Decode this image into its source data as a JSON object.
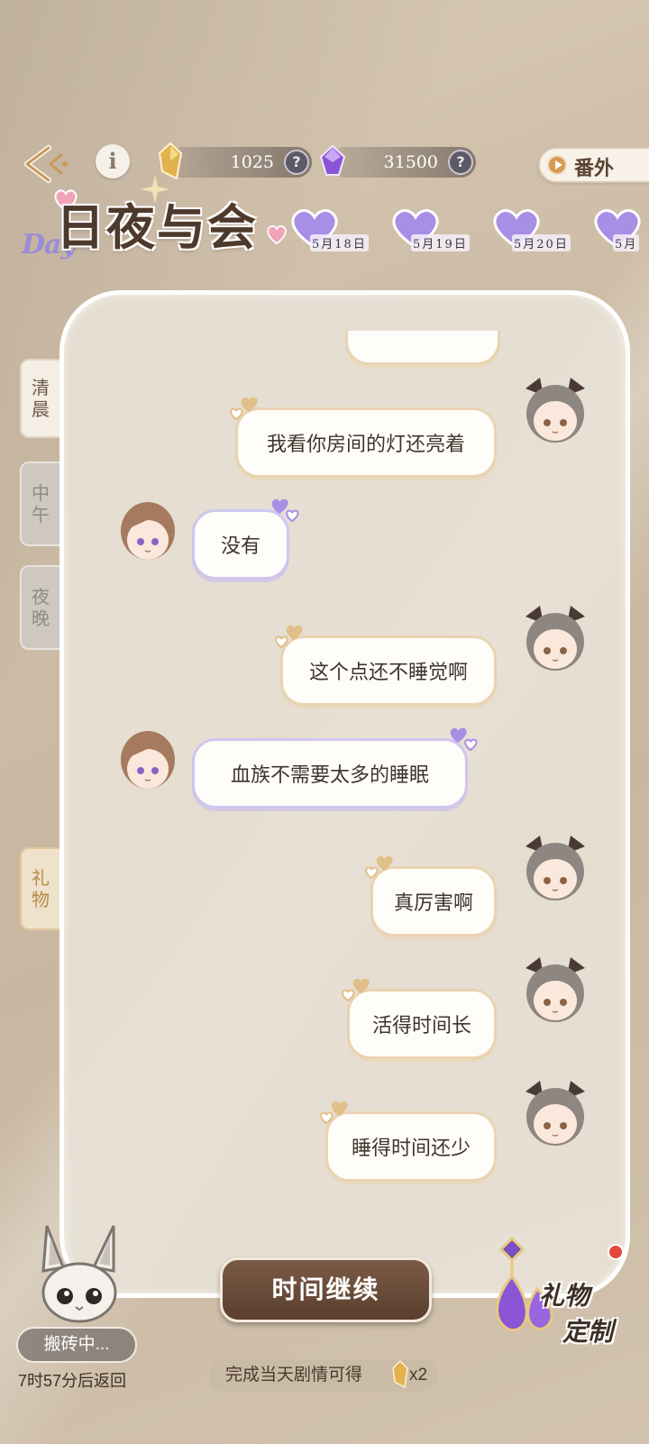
{
  "header": {
    "back_icon": "back-arrow-icon",
    "info_icon": "info-icon",
    "currencies": [
      {
        "icon": "gold-crystal-icon",
        "value": "1025",
        "help": "?"
      },
      {
        "icon": "purple-gem-icon",
        "value": "31500",
        "help": "?"
      }
    ],
    "extra_label": "番外"
  },
  "logo": {
    "day_text": "Day",
    "title": "日夜与会"
  },
  "dates": [
    "5月18日",
    "5月19日",
    "5月20日",
    "5月"
  ],
  "side_tabs": {
    "morning": [
      "清",
      "晨"
    ],
    "noon": [
      "中",
      "午"
    ],
    "night": [
      "夜",
      "晚"
    ],
    "gift": [
      "礼",
      "物"
    ]
  },
  "chat": {
    "messages": [
      {
        "from": "me",
        "text": ""
      },
      {
        "from": "me",
        "text": "我看你房间的灯还亮着"
      },
      {
        "from": "him",
        "text": "没有"
      },
      {
        "from": "me",
        "text": "这个点还不睡觉啊"
      },
      {
        "from": "him",
        "text": "血族不需要太多的睡眠"
      },
      {
        "from": "me",
        "text": "真厉害啊"
      },
      {
        "from": "me",
        "text": "活得时间长"
      },
      {
        "from": "me",
        "text": "睡得时间还少"
      }
    ]
  },
  "footer": {
    "continue_label": "时间继续",
    "reward_text": "完成当天剧情可得",
    "reward_multiplier": "x2",
    "pet_status": "搬砖中...",
    "pet_return": "7时57分后返回",
    "gift_custom_1": "礼物",
    "gift_custom_2": "定制"
  },
  "colors": {
    "accent_gold": "#e9d3b1",
    "accent_purple": "#cfc6ef",
    "button_brown": "#6a4a37"
  }
}
